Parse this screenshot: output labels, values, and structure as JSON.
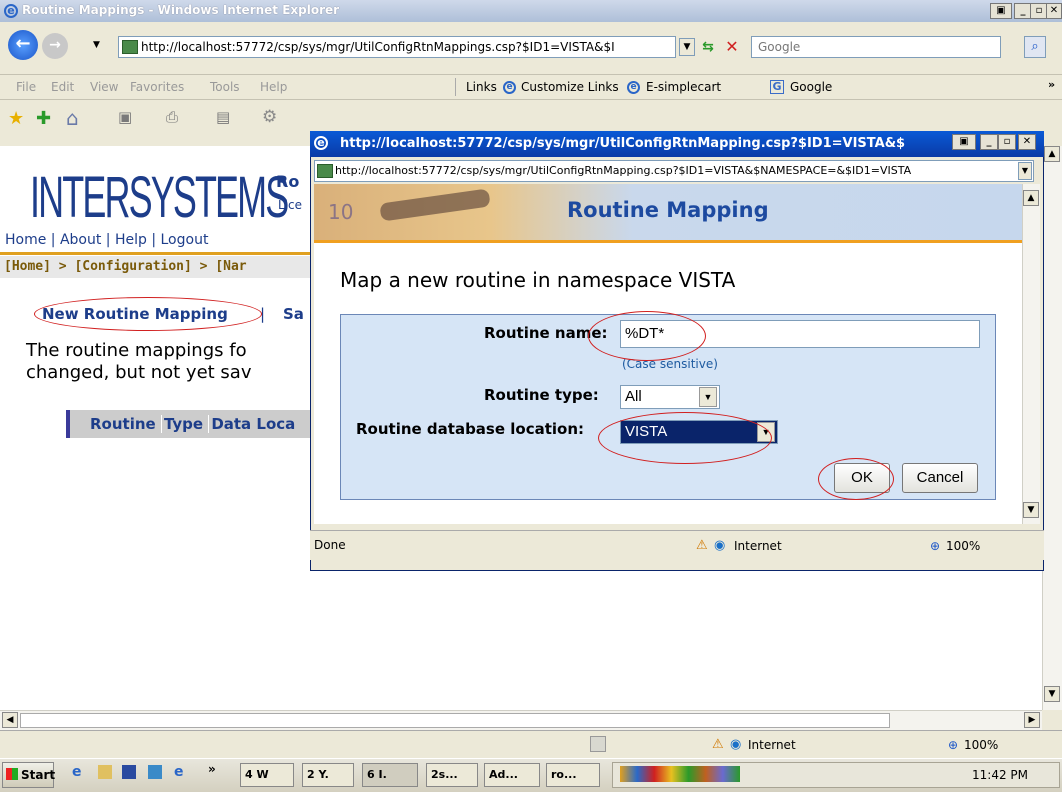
{
  "window": {
    "title": "Routine Mappings - Windows Internet Explorer"
  },
  "nav": {
    "address": "http://localhost:57772/csp/sys/mgr/UtilConfigRtnMappings.csp?$ID1=VISTA&$I",
    "search_placeholder": "Google"
  },
  "menu": {
    "file": "File",
    "edit": "Edit",
    "view": "View",
    "favorites": "Favorites",
    "tools": "Tools",
    "help": "Help"
  },
  "links_bar": {
    "links": "Links",
    "customize": "Customize Links",
    "esimplecart": "E-simplecart",
    "google": "Google"
  },
  "page": {
    "logo": "INTERSYSTEMS",
    "logo_partial": "Ro",
    "license_partial": "Lice",
    "toplinks": "Home | About | Help | Logout",
    "breadcrumb": "[Home] > [Configuration] > [Nar",
    "new_mapping": "New Routine Mapping",
    "separator": "|",
    "save_partial": "Sa",
    "desc_line1": "The routine mappings fo",
    "desc_line2": "changed, but not yet sav",
    "col_routine": "Routine",
    "col_type": "Type",
    "col_data": "Data Loca"
  },
  "popup": {
    "title": "http://localhost:57772/csp/sys/mgr/UtilConfigRtnMapping.csp?$ID1=VISTA&$",
    "address": "http://localhost:57772/csp/sys/mgr/UtilConfigRtnMapping.csp?$ID1=VISTA&$NAMESPACE=&$ID1=VISTA",
    "banner_title": "Routine Mapping",
    "banner_number": "10",
    "heading": "Map a new routine in namespace VISTA",
    "routine_name_label": "Routine name:",
    "routine_name_value": "%DT*",
    "case_hint": "(Case sensitive)",
    "routine_type_label": "Routine type:",
    "routine_type_value": "All",
    "db_location_label": "Routine database location:",
    "db_location_value": "VISTA",
    "ok": "OK",
    "cancel": "Cancel",
    "status": "Done",
    "zone": "Internet",
    "zoom": "100%"
  },
  "statusbar": {
    "zone": "Internet",
    "zoom": "100%"
  },
  "taskbar": {
    "start": "Start",
    "tasks": [
      "4 W",
      "2 Y.",
      "6 I.",
      "2s...",
      "Ad...",
      "ro..."
    ],
    "clock": "11:42 PM"
  }
}
